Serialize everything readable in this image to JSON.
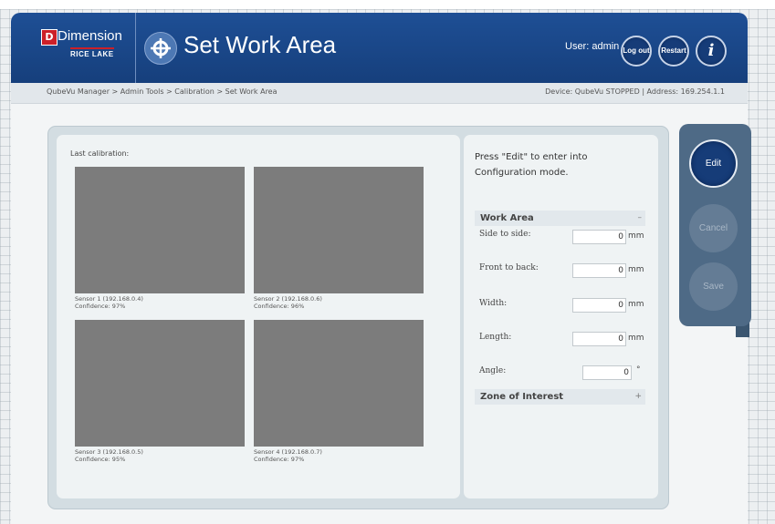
{
  "header": {
    "brand_name": "Dimension",
    "brand_maker": "RICE LAKE",
    "page_title": "Set Work Area",
    "user_label": "User: admin",
    "logout_label": "Log out",
    "restart_label": "Restart",
    "info_label": "i"
  },
  "subbar": {
    "breadcrumb": "QubeVu Manager > Admin Tools > Calibration > Set Work Area",
    "device_status": "Device: QubeVu STOPPED | Address: 169.254.1.1"
  },
  "calibration": {
    "heading": "Last calibration:",
    "sensors": [
      {
        "name": "Sensor 1 (192.168.0.4)",
        "confidence": "Confidence: 97%"
      },
      {
        "name": "Sensor 2 (192.168.0.6)",
        "confidence": "Confidence: 96%"
      },
      {
        "name": "Sensor 3 (192.168.0.5)",
        "confidence": "Confidence: 95%"
      },
      {
        "name": "Sensor 4 (192.168.0.7)",
        "confidence": "Confidence: 97%"
      }
    ]
  },
  "config": {
    "instructions": "Press \"Edit\" to enter into Configuration mode.",
    "work_area_title": "Work Area",
    "work_area_toggle": "–",
    "fields": [
      {
        "label": "Side to side:",
        "value": "0",
        "unit": "mm"
      },
      {
        "label": "Front to back:",
        "value": "0",
        "unit": "mm"
      },
      {
        "label": "Width:",
        "value": "0",
        "unit": "mm"
      },
      {
        "label": "Length:",
        "value": "0",
        "unit": "mm"
      },
      {
        "label": "Angle:",
        "value": "0",
        "unit": "°"
      }
    ],
    "zone_title": "Zone of Interest",
    "zone_toggle": "+"
  },
  "actions": {
    "edit": "Edit",
    "cancel": "Cancel",
    "save": "Save"
  }
}
